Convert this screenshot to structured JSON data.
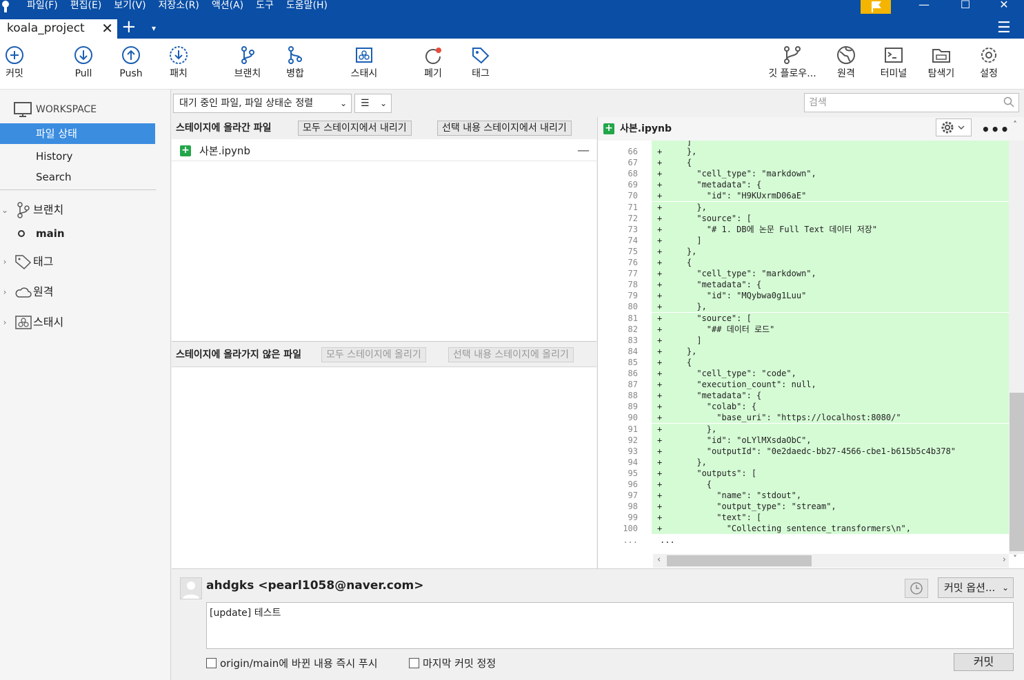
{
  "menu": [
    "파일(F)",
    "편집(E)",
    "보기(V)",
    "저장소(R)",
    "액션(A)",
    "도구",
    "도움말(H)"
  ],
  "tab": {
    "title": "koala_project",
    "close": "✕",
    "plus": "+",
    "caret": "▾"
  },
  "toolbar": {
    "commit": "커밋",
    "pull": "Pull",
    "push": "Push",
    "patch": "패치",
    "branch": "브랜치",
    "merge": "병합",
    "stash": "스태시",
    "discard": "폐기",
    "tag": "태그",
    "gitflow": "깃 플로우...",
    "remote": "원격",
    "terminal": "터미널",
    "explorer": "탐색기",
    "settings": "설정"
  },
  "sidebar": {
    "workspace": "WORKSPACE",
    "items": [
      "파일 상태",
      "History",
      "Search"
    ],
    "branches": "브랜치",
    "current_branch": "main",
    "tags": "태그",
    "remotes": "원격",
    "stashes": "스태시"
  },
  "filter": {
    "sort": "대기 중인 파일, 파일 상태순 정렬",
    "view": "☰",
    "search_placeholder": "검색"
  },
  "staged": {
    "title": "스테이지에 올라간 파일",
    "unstage_all": "모두 스테이지에서 내리기",
    "unstage_selected": "선택 내용 스테이지에서 내리기",
    "files": [
      "사본.ipynb"
    ]
  },
  "unstaged": {
    "title": "스테이지에 올라가지 않은 파일",
    "stage_all": "모두 스테이지에 올리기",
    "stage_selected": "선택 내용 스테이지에 올리기"
  },
  "diff": {
    "filename": "사본.ipynb",
    "lines": [
      {
        "n": "66",
        "code": "    },"
      },
      {
        "n": "67",
        "code": "    {"
      },
      {
        "n": "68",
        "code": "      \"cell_type\": \"markdown\","
      },
      {
        "n": "69",
        "code": "      \"metadata\": {"
      },
      {
        "n": "70",
        "code": "        \"id\": \"H9KUxrmD06aE\""
      },
      {
        "n": "71",
        "code": "      },"
      },
      {
        "n": "72",
        "code": "      \"source\": ["
      },
      {
        "n": "73",
        "code": "        \"# 1. DB에 논문 Full Text 데이터 저장\""
      },
      {
        "n": "74",
        "code": "      ]"
      },
      {
        "n": "75",
        "code": "    },"
      },
      {
        "n": "76",
        "code": "    {"
      },
      {
        "n": "77",
        "code": "      \"cell_type\": \"markdown\","
      },
      {
        "n": "78",
        "code": "      \"metadata\": {"
      },
      {
        "n": "79",
        "code": "        \"id\": \"MQybwa0g1Luu\""
      },
      {
        "n": "80",
        "code": "      },"
      },
      {
        "n": "81",
        "code": "      \"source\": ["
      },
      {
        "n": "82",
        "code": "        \"## 데이터 로드\""
      },
      {
        "n": "83",
        "code": "      ]"
      },
      {
        "n": "84",
        "code": "    },"
      },
      {
        "n": "85",
        "code": "    {"
      },
      {
        "n": "86",
        "code": "      \"cell_type\": \"code\","
      },
      {
        "n": "87",
        "code": "      \"execution_count\": null,"
      },
      {
        "n": "88",
        "code": "      \"metadata\": {"
      },
      {
        "n": "89",
        "code": "        \"colab\": {"
      },
      {
        "n": "90",
        "code": "          \"base_uri\": \"https://localhost:8080/\""
      },
      {
        "n": "91",
        "code": "        },"
      },
      {
        "n": "92",
        "code": "        \"id\": \"oLYlMXsdaObC\","
      },
      {
        "n": "93",
        "code": "        \"outputId\": \"0e2daedc-bb27-4566-cbe1-b615b5c4b378\""
      },
      {
        "n": "94",
        "code": "      },"
      },
      {
        "n": "95",
        "code": "      \"outputs\": ["
      },
      {
        "n": "96",
        "code": "        {"
      },
      {
        "n": "97",
        "code": "          \"name\": \"stdout\","
      },
      {
        "n": "98",
        "code": "          \"output_type\": \"stream\","
      },
      {
        "n": "99",
        "code": "          \"text\": ["
      },
      {
        "n": "100",
        "code": "            \"Collecting sentence_transformers\\n\","
      }
    ],
    "ellipsis_ln": "...",
    "ellipsis_code": "..."
  },
  "commit": {
    "author": "ahdgks <pearl1058@naver.com>",
    "options": "커밋 옵션...",
    "message": "[update] 테스트",
    "push_now": "origin/main에 바뀐 내용 즉시 푸시",
    "amend": "마지막 커밋 정정",
    "button": "커밋"
  },
  "colors": {
    "accent": "#0a4ea5",
    "selection": "#3b8de0",
    "added": "#d5fbd5",
    "add_icon": "#22a64a",
    "icon_blue": "#1a5fb4"
  }
}
